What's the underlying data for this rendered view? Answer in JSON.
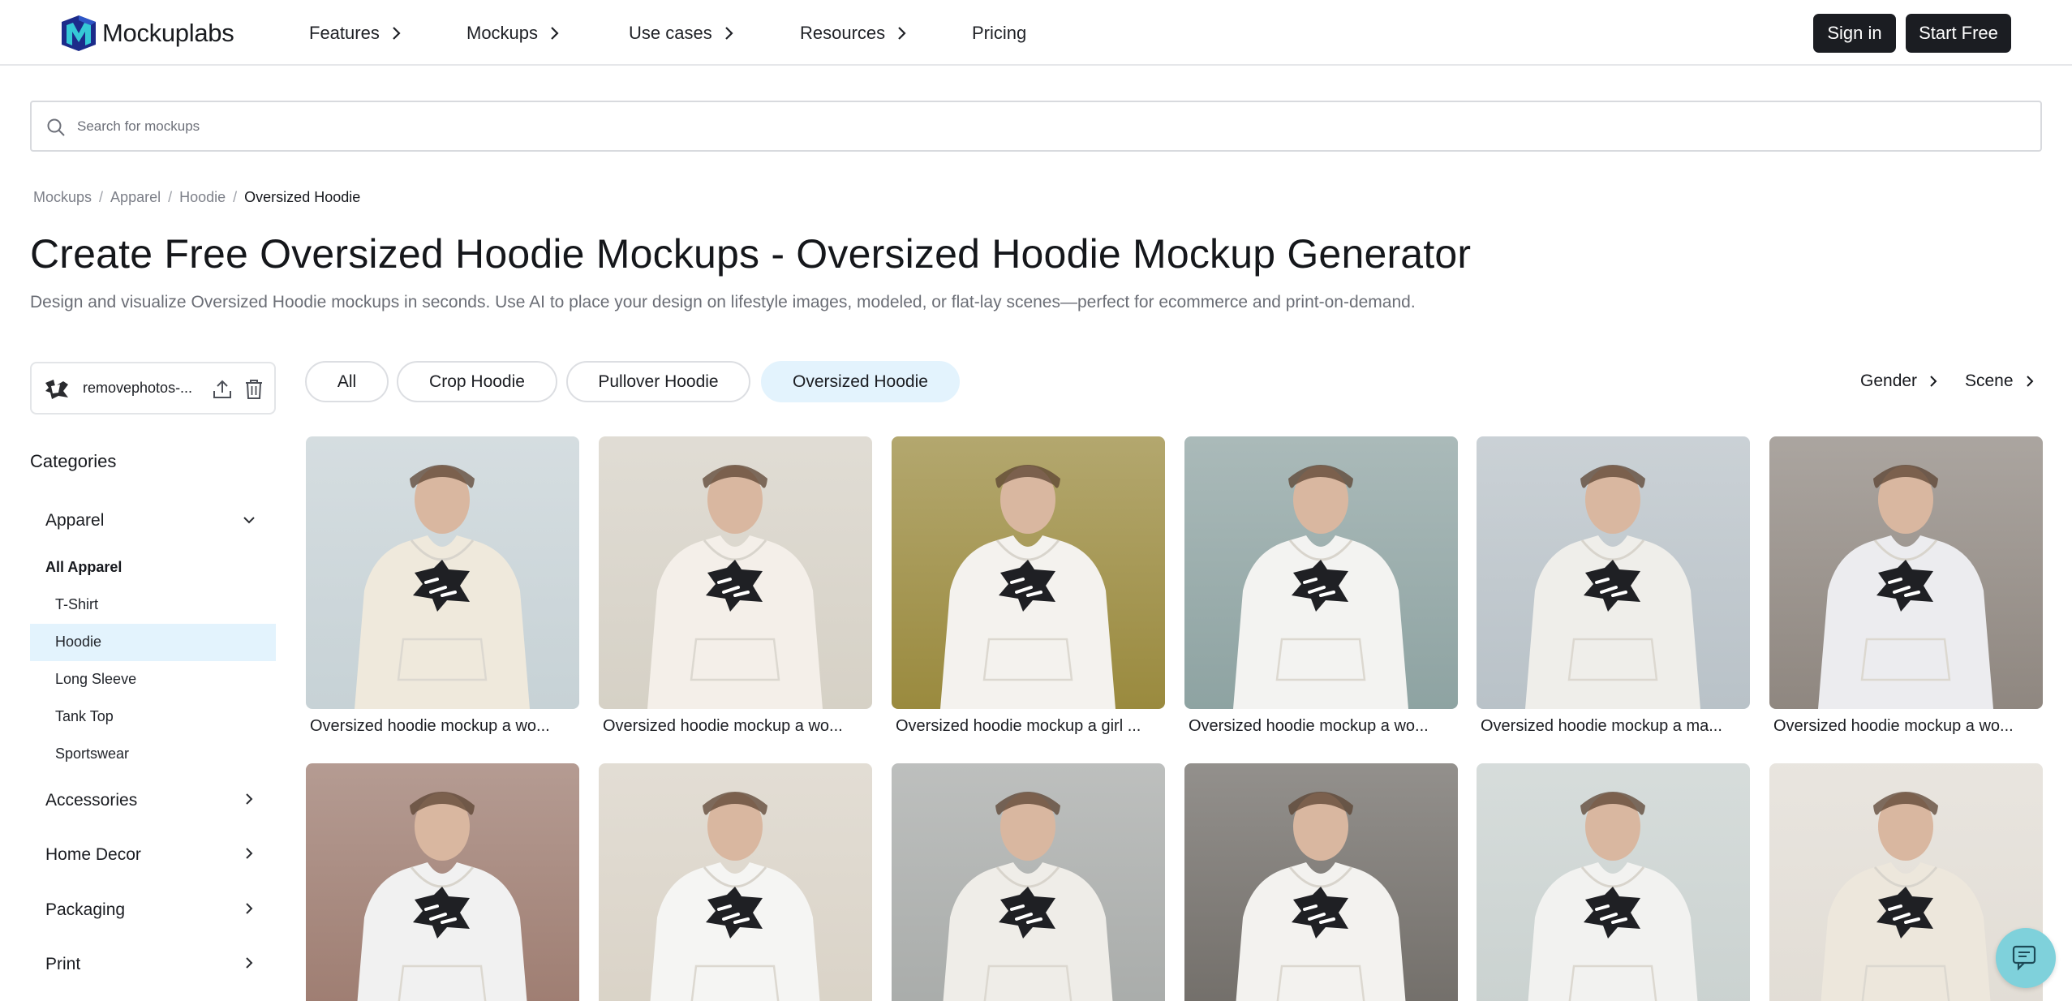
{
  "brand": {
    "name": "Mockuplabs"
  },
  "nav": {
    "links": [
      "Features",
      "Mockups",
      "Use cases",
      "Resources"
    ],
    "pricing": "Pricing",
    "sign_in": "Sign in",
    "start_free": "Start Free"
  },
  "search": {
    "placeholder": "Search for mockups"
  },
  "breadcrumb": {
    "items": [
      "Mockups",
      "Apparel",
      "Hoodie"
    ],
    "current": "Oversized Hoodie"
  },
  "page": {
    "title": "Create Free Oversized Hoodie Mockups - Oversized Hoodie Mockup Generator",
    "subtitle": "Design and visualize Oversized Hoodie mockups in seconds. Use AI to place your design on lifestyle images, modeled, or flat-lay scenes—perfect for ecommerce and print-on-demand."
  },
  "upload": {
    "filename": "removephotos-..."
  },
  "sidebar": {
    "title": "Categories",
    "apparel": "Apparel",
    "all_apparel": "All Apparel",
    "apparel_items": [
      "T-Shirt",
      "Hoodie",
      "Long Sleeve",
      "Tank Top",
      "Sportswear"
    ],
    "active_item": "Hoodie",
    "categories": [
      "Accessories",
      "Home Decor",
      "Packaging",
      "Print"
    ]
  },
  "filters": {
    "pills": [
      "All",
      "Crop Hoodie",
      "Pullover Hoodie",
      "Oversized Hoodie"
    ],
    "active_pill": "Oversized Hoodie",
    "dropdowns": [
      "Gender",
      "Scene"
    ]
  },
  "mockups": [
    {
      "caption": "Oversized hoodie mockup a wo...",
      "bg": "#c7d2d6",
      "garment": "#efe9dc"
    },
    {
      "caption": "Oversized hoodie mockup a wo...",
      "bg": "#d6d1c6",
      "garment": "#f4efe9"
    },
    {
      "caption": "Oversized hoodie mockup a girl ...",
      "bg": "#9a8a3e",
      "garment": "#f4f2ee"
    },
    {
      "caption": "Oversized hoodie mockup a wo...",
      "bg": "#8ea3a2",
      "garment": "#f3f3f1"
    },
    {
      "caption": "Oversized hoodie mockup a ma...",
      "bg": "#b9c2c8",
      "garment": "#efeeea"
    },
    {
      "caption": "Oversized hoodie mockup a wo...",
      "bg": "#8f8780",
      "garment": "#ececef"
    },
    {
      "caption": "",
      "bg": "#9c7a6e",
      "garment": "#f1f1f1"
    },
    {
      "caption": "",
      "bg": "#d9d2c6",
      "garment": "#f5f5f3"
    },
    {
      "caption": "",
      "bg": "#a7aaa8",
      "garment": "#efede8"
    },
    {
      "caption": "",
      "bg": "#6f6b66",
      "garment": "#f3f2ef"
    },
    {
      "caption": "",
      "bg": "#c9d1cf",
      "garment": "#f2f2f0"
    },
    {
      "caption": "",
      "bg": "#e1dcd4",
      "garment": "#ede7dc"
    }
  ],
  "colors": {
    "accent_light": "#e3f3fd",
    "dark_button": "#1b1d22",
    "chat_button": "#7fd1db"
  },
  "icons": {
    "search": "search-icon",
    "chevron": "chevron-right-icon",
    "upload": "upload-icon",
    "trash": "trash-icon",
    "chat": "chat-icon"
  }
}
